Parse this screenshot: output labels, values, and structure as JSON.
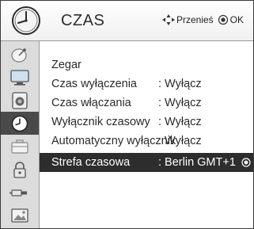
{
  "header": {
    "title": "CZAS",
    "hint_move": "Przenieś",
    "hint_ok": "OK"
  },
  "sidebar": {
    "items": [
      {
        "icon": "satellite-dish-icon",
        "selected": false
      },
      {
        "icon": "monitor-icon",
        "selected": false
      },
      {
        "icon": "speaker-icon",
        "selected": false
      },
      {
        "icon": "clock-icon",
        "selected": true
      },
      {
        "icon": "briefcase-icon",
        "selected": false
      },
      {
        "icon": "lock-icon",
        "selected": false
      },
      {
        "icon": "input-plug-icon",
        "selected": false
      },
      {
        "icon": "photo-icon",
        "selected": false
      }
    ]
  },
  "menu": {
    "items": [
      {
        "label": "Zegar",
        "value": ""
      },
      {
        "label": "Czas wyłączenia",
        "value": ": Wyłącz"
      },
      {
        "label": "Czas włączania",
        "value": ": Wyłącz"
      },
      {
        "label": "Wyłącznik czasowy",
        "value": ": Wyłącz"
      },
      {
        "label": "Automatyczny wyłącznik",
        "value": ": Wyłącz"
      },
      {
        "label": "Strefa czasowa",
        "value": ": Berlin GMT+1",
        "selected": true
      }
    ]
  },
  "colors": {
    "selected_bg": "#2d2d2d",
    "sidebar_bg": "#dcdcdc",
    "sidebar_selected_bg": "#4a4a4a"
  }
}
